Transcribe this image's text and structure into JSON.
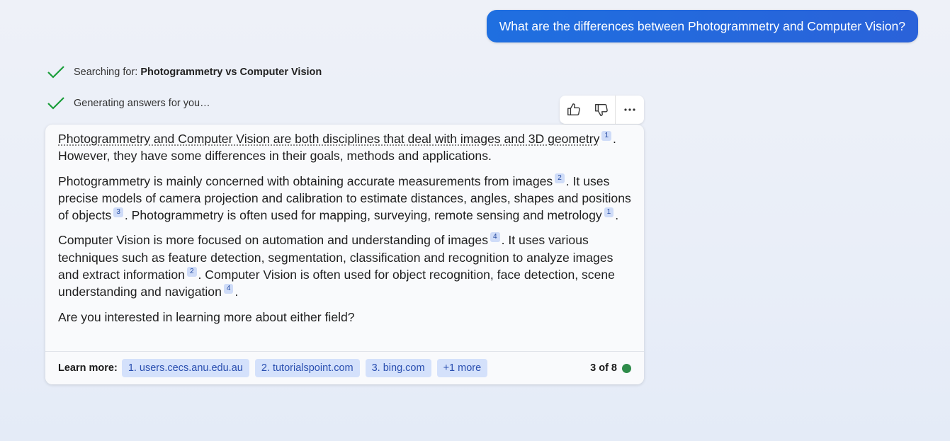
{
  "user_message": "What are the differences between Photogrammetry and Computer Vision?",
  "status": [
    {
      "prefix": "Searching for: ",
      "bold": "Photogrammetry vs Computer Vision"
    },
    {
      "prefix": "Generating answers for you…",
      "bold": ""
    }
  ],
  "feedback": {
    "like_icon": "thumbs-up-icon",
    "dislike_icon": "thumbs-down-icon",
    "more_icon": "more-options-icon"
  },
  "answer": {
    "p1": {
      "t1": "Photogrammetry and Computer Vision are both disciplines that deal with images and 3D geometry",
      "c1": "1",
      "t2": ". However, they have some differences in their goals, methods and applications."
    },
    "p2": {
      "t1": "Photogrammetry is mainly concerned with obtaining accurate measurements from images",
      "c1": "2",
      "t2": ". It uses precise models of camera projection and calibration to estimate distances, angles, shapes and positions of objects",
      "c2": "3",
      "t3": ". Photogrammetry is often used for mapping, surveying, remote sensing and metrology",
      "c3": "1",
      "t4": "."
    },
    "p3": {
      "t1": "Computer Vision is more focused on automation and understanding of images",
      "c1": "4",
      "t2": ". It uses various techniques such as feature detection, segmentation, classification and recognition to analyze images and extract information",
      "c2": "2",
      "t3": ". Computer Vision is often used for object recognition, face detection, scene understanding and navigation",
      "c3": "4",
      "t4": "."
    },
    "p4": "Are you interested in learning more about either field?"
  },
  "learn_more": {
    "label": "Learn more:",
    "sources": [
      "1. users.cecs.anu.edu.au",
      "2. tutorialspoint.com",
      "3. bing.com",
      "+1 more"
    ],
    "counter": "3 of 8",
    "status_color": "#2e8b4a"
  }
}
